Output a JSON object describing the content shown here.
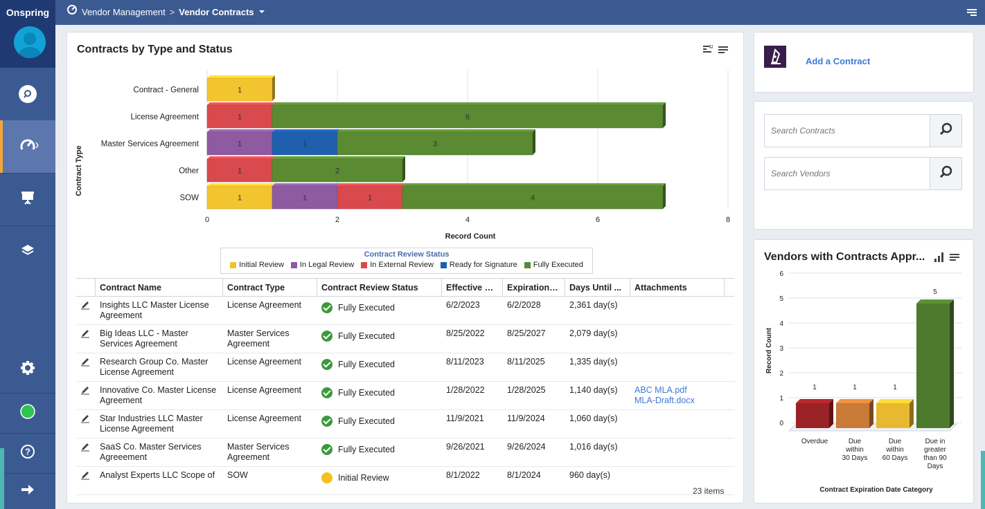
{
  "app": {
    "brand": "Onspring"
  },
  "breadcrumb": {
    "parent": "Vendor Management",
    "separator": ">",
    "current": "Vendor Contracts"
  },
  "contracts_chart": {
    "title": "Contracts by Type and Status",
    "ylabel": "Contract Type",
    "xlabel": "Record Count",
    "legend_title": "Contract Review Status"
  },
  "chart_data": [
    {
      "type": "bar",
      "orientation": "horizontal",
      "stacked": true,
      "title": "Contracts by Type and Status",
      "xlabel": "Record Count",
      "ylabel": "Contract Type",
      "xlim": [
        0,
        8
      ],
      "xticks": [
        "0",
        "2",
        "4",
        "6",
        "8"
      ],
      "categories": [
        "Contract - General",
        "License Agreement",
        "Master Services Agreement",
        "Other",
        "SOW"
      ],
      "legend": {
        "title": "Contract Review Status",
        "placement": "bottom"
      },
      "series": [
        {
          "name": "Initial Review",
          "color": "#f2c530",
          "values": [
            1,
            0,
            0,
            0,
            1
          ]
        },
        {
          "name": "In Legal Review",
          "color": "#8e5aa0",
          "values": [
            0,
            0,
            1,
            0,
            1
          ]
        },
        {
          "name": "In External Review",
          "color": "#d84a4d",
          "values": [
            0,
            1,
            0,
            1,
            1
          ]
        },
        {
          "name": "Ready for Signature",
          "color": "#1e5fae",
          "values": [
            0,
            0,
            1,
            0,
            0
          ]
        },
        {
          "name": "Fully Executed",
          "color": "#5a8a32",
          "values": [
            0,
            6,
            3,
            2,
            4
          ]
        }
      ]
    },
    {
      "type": "bar",
      "title": "Vendors with Contracts Appr...",
      "xlabel": "Contract Expiration Date Category",
      "ylabel": "Record Count",
      "ylim": [
        0,
        6
      ],
      "yticks": [
        "0",
        "1",
        "2",
        "3",
        "4",
        "5",
        "6"
      ],
      "categories": [
        "Overdue",
        "Due within 30 Days",
        "Due within 60 Days",
        "Due in greater than 90 Days"
      ],
      "values": [
        1,
        1,
        1,
        5
      ],
      "colors": [
        "#9b2226",
        "#c87a36",
        "#e8b830",
        "#4e7a2e"
      ]
    }
  ],
  "table": {
    "columns": [
      "Contract Name",
      "Contract Type",
      "Contract Review Status",
      "Effective D...",
      "Expiration ... ↓",
      "Days Until ...",
      "Attachments"
    ],
    "rows": [
      {
        "name": "Insights LLC Master License Agreement",
        "type": "License Agreement",
        "status": "Fully Executed",
        "effective": "6/2/2023",
        "expiration": "6/2/2028",
        "days": "2,361 day(s)",
        "att1": "",
        "att2": ""
      },
      {
        "name": "Big Ideas LLC - Master Services Agreement",
        "type": "Master Services Agreement",
        "status": "Fully Executed",
        "effective": "8/25/2022",
        "expiration": "8/25/2027",
        "days": "2,079 day(s)",
        "att1": "",
        "att2": ""
      },
      {
        "name": "Research Group Co. Master License Agreement",
        "type": "License Agreement",
        "status": "Fully Executed",
        "effective": "8/11/2023",
        "expiration": "8/11/2025",
        "days": "1,335 day(s)",
        "att1": "",
        "att2": ""
      },
      {
        "name": "Innovative Co. Master License Agreement",
        "type": "License Agreement",
        "status": "Fully Executed",
        "effective": "1/28/2022",
        "expiration": "1/28/2025",
        "days": "1,140 day(s)",
        "att1": "ABC MLA.pdf",
        "att2": "MLA-Draft.docx"
      },
      {
        "name": "Star Industries LLC Master License Agreement",
        "type": "License Agreement",
        "status": "Fully Executed",
        "effective": "11/9/2021",
        "expiration": "11/9/2024",
        "days": "1,060 day(s)",
        "att1": "",
        "att2": ""
      },
      {
        "name": "SaaS Co. Master Services Agreeement",
        "type": "Master Services Agreement",
        "status": "Fully Executed",
        "effective": "9/26/2021",
        "expiration": "9/26/2024",
        "days": "1,016 day(s)",
        "att1": "",
        "att2": ""
      },
      {
        "name": "Analyst Experts LLC Scope of",
        "type": "SOW",
        "status": "Initial Review",
        "effective": "8/1/2022",
        "expiration": "8/1/2024",
        "days": "960 day(s)",
        "att1": "",
        "att2": ""
      }
    ],
    "items_count": "23 items"
  },
  "add_contract": {
    "label": "Add a Contract"
  },
  "search": {
    "contracts_placeholder": "Search Contracts",
    "vendors_placeholder": "Search Vendors"
  },
  "vendors_chart": {
    "title": "Vendors with Contracts Appr...",
    "ylabel": "Record Count",
    "xlabel": "Contract Expiration Date Category"
  },
  "colors": {
    "topbar": "#3c5a92",
    "brand_bg": "#1f3a73",
    "accent": "#f3a53a",
    "link": "#3a7bd5",
    "status_ok": "#3b9a3b",
    "status_initial": "#f3c11f"
  }
}
